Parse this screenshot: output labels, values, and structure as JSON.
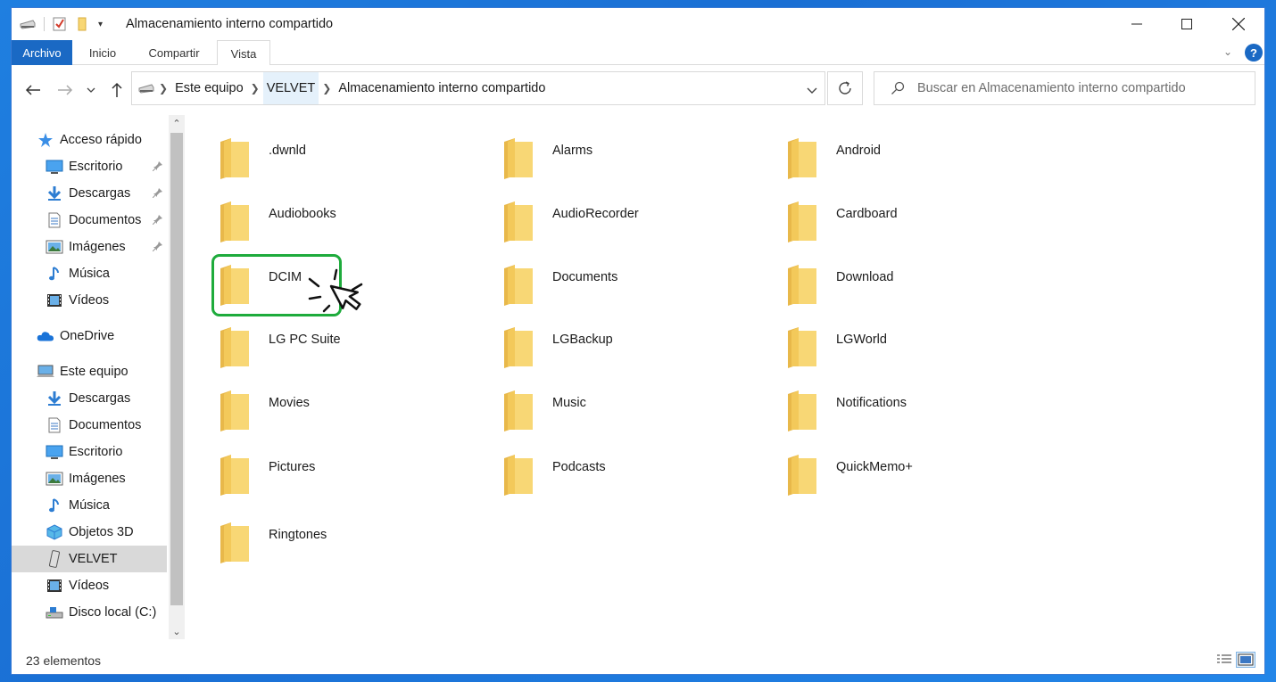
{
  "window": {
    "title": "Almacenamiento interno compartido",
    "minimize_label": "",
    "help_label": "?"
  },
  "ribbon": {
    "tabs": [
      {
        "label": "Archivo"
      },
      {
        "label": "Inicio"
      },
      {
        "label": "Compartir"
      },
      {
        "label": "Vista"
      }
    ]
  },
  "address": {
    "crumbs": [
      {
        "label": "Este equipo"
      },
      {
        "label": "VELVET"
      },
      {
        "label": "Almacenamiento interno compartido"
      }
    ]
  },
  "search": {
    "placeholder": "Buscar en Almacenamiento interno compartido"
  },
  "sidebar": {
    "items": [
      {
        "label": "Acceso rápido",
        "icon": "star-icon"
      },
      {
        "label": "Escritorio",
        "icon": "desktop-icon",
        "pinned": true
      },
      {
        "label": "Descargas",
        "icon": "download-arrow-icon",
        "pinned": true
      },
      {
        "label": "Documentos",
        "icon": "document-icon",
        "pinned": true
      },
      {
        "label": "Imágenes",
        "icon": "pictures-icon",
        "pinned": true
      },
      {
        "label": "Música",
        "icon": "music-note-icon"
      },
      {
        "label": "Vídeos",
        "icon": "film-icon"
      },
      {
        "label": "OneDrive",
        "icon": "cloud-icon"
      },
      {
        "label": "Este equipo",
        "icon": "computer-icon"
      },
      {
        "label": "Descargas",
        "icon": "download-arrow-icon"
      },
      {
        "label": "Documentos",
        "icon": "document-icon"
      },
      {
        "label": "Escritorio",
        "icon": "desktop-icon"
      },
      {
        "label": "Imágenes",
        "icon": "pictures-icon"
      },
      {
        "label": "Música",
        "icon": "music-note-icon"
      },
      {
        "label": "Objetos 3D",
        "icon": "cube-3d-icon"
      },
      {
        "label": "VELVET",
        "icon": "phone-icon",
        "selected": true
      },
      {
        "label": "Vídeos",
        "icon": "film-icon"
      },
      {
        "label": "Disco local (C:)",
        "icon": "drive-icon"
      }
    ]
  },
  "folders": [
    {
      "name": ".dwnld"
    },
    {
      "name": "Alarms"
    },
    {
      "name": "Android"
    },
    {
      "name": "Audiobooks"
    },
    {
      "name": "AudioRecorder"
    },
    {
      "name": "Cardboard"
    },
    {
      "name": "DCIM"
    },
    {
      "name": "Documents"
    },
    {
      "name": "Download"
    },
    {
      "name": "LG PC Suite"
    },
    {
      "name": "LGBackup"
    },
    {
      "name": "LGWorld"
    },
    {
      "name": "Movies"
    },
    {
      "name": "Music"
    },
    {
      "name": "Notifications"
    },
    {
      "name": "Pictures"
    },
    {
      "name": "Podcasts"
    },
    {
      "name": "QuickMemo+"
    },
    {
      "name": "Ringtones"
    }
  ],
  "status": {
    "count_text": "23 elementos"
  },
  "colors": {
    "accent": "#1a69c4",
    "highlight_border": "#1eab3c",
    "folder_yellow": "#f8d775",
    "desktop_bg": "#1f7fe0"
  }
}
